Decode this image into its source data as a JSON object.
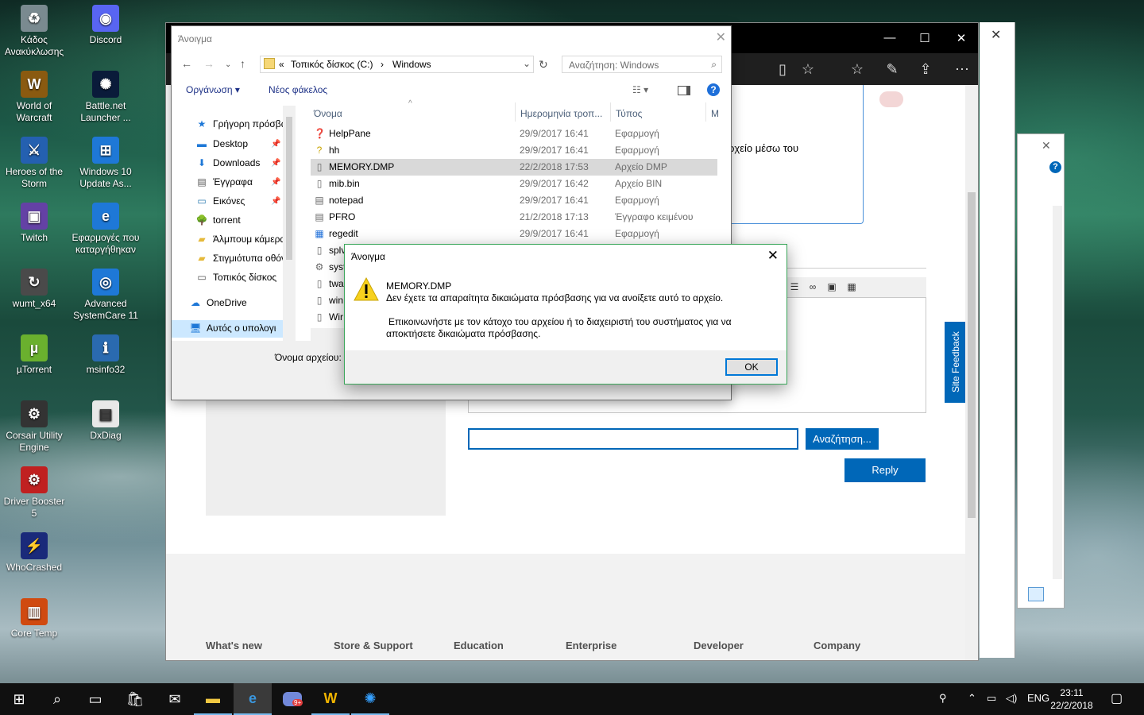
{
  "desktop": {
    "icons": [
      {
        "label": "Κάδος Ανακύκλωσης",
        "icon": "recycle-bin-icon"
      },
      {
        "label": "Discord",
        "icon": "discord-icon"
      },
      {
        "label": "World of Warcraft",
        "icon": "wow-icon"
      },
      {
        "label": "Battle.net Launcher ...",
        "icon": "battlenet-icon"
      },
      {
        "label": "Heroes of the Storm",
        "icon": "hots-icon"
      },
      {
        "label": "Windows 10 Update As...",
        "icon": "windows-update-icon"
      },
      {
        "label": "Twitch",
        "icon": "twitch-icon"
      },
      {
        "label": "Εφαρμογές που καταργήθηκαν",
        "icon": "edge-file-icon"
      },
      {
        "label": "wumt_x64",
        "icon": "wumt-icon"
      },
      {
        "label": "Advanced SystemCare 11",
        "icon": "systemcare-icon"
      },
      {
        "label": "µTorrent",
        "icon": "utorrent-icon"
      },
      {
        "label": "msinfo32",
        "icon": "msinfo-icon"
      },
      {
        "label": "Corsair Utility Engine",
        "icon": "corsair-icon"
      },
      {
        "label": "DxDiag",
        "icon": "dxdiag-icon"
      },
      {
        "label": "Driver Booster 5",
        "icon": "driver-booster-icon"
      },
      {
        "label": "WhoCrashed",
        "icon": "whocrashed-icon"
      },
      {
        "label": "Core Temp",
        "icon": "coretemp-icon"
      }
    ]
  },
  "edge": {
    "partial_text": "ρχείο μέσω του",
    "search_button": "Αναζήτηση...",
    "reply_button": "Reply",
    "site_feedback": "Site Feedback",
    "footer": [
      "What's new",
      "Store & Support",
      "Education",
      "Enterprise",
      "Developer",
      "Company"
    ]
  },
  "file_dialog": {
    "title": "Άνοιγμα",
    "address": {
      "prefix": "«",
      "drive": "Τοπικός δίσκος (C:)",
      "folder": "Windows"
    },
    "search_placeholder": "Αναζήτηση: Windows",
    "commands": {
      "organize": "Οργάνωση",
      "new_folder": "Νέος φάκελος"
    },
    "nav": [
      {
        "label": "Γρήγορη πρόσβαση",
        "icon": "star-icon",
        "pinned": false
      },
      {
        "label": "Desktop",
        "icon": "desktop-folder-icon",
        "pinned": true
      },
      {
        "label": "Downloads",
        "icon": "downloads-icon",
        "pinned": true
      },
      {
        "label": "Έγγραφα",
        "icon": "documents-icon",
        "pinned": true
      },
      {
        "label": "Εικόνες",
        "icon": "pictures-icon",
        "pinned": true
      },
      {
        "label": "torrent",
        "icon": "torrent-folder-icon",
        "pinned": false
      },
      {
        "label": "Άλμπουμ κάμερας",
        "icon": "folder-icon",
        "pinned": false
      },
      {
        "label": "Στιγμιότυπα οθόνης",
        "icon": "folder-icon",
        "pinned": false
      },
      {
        "label": "Τοπικός δίσκος",
        "icon": "drive-icon",
        "pinned": false
      },
      {
        "label": "OneDrive",
        "icon": "onedrive-icon",
        "pinned": false
      },
      {
        "label": "Αυτός ο υπολογιστής",
        "icon": "this-pc-icon",
        "pinned": false
      }
    ],
    "columns": {
      "name": "Όνομα",
      "date": "Ημερομηνία τροπ...",
      "type": "Τύπος",
      "size": "Μ"
    },
    "files": [
      {
        "name": "HelpPane",
        "date": "29/9/2017 16:41",
        "type": "Εφαρμογή",
        "icon": "help-icon"
      },
      {
        "name": "hh",
        "date": "29/9/2017 16:41",
        "type": "Εφαρμογή",
        "icon": "help-file-icon"
      },
      {
        "name": "MEMORY.DMP",
        "date": "22/2/2018 17:53",
        "type": "Αρχείο DMP",
        "icon": "file-icon"
      },
      {
        "name": "mib.bin",
        "date": "29/9/2017 16:42",
        "type": "Αρχείο BIN",
        "icon": "file-icon"
      },
      {
        "name": "notepad",
        "date": "29/9/2017 16:41",
        "type": "Εφαρμογή",
        "icon": "notepad-icon"
      },
      {
        "name": "PFRO",
        "date": "21/2/2018 17:13",
        "type": "Έγγραφο κειμένου",
        "icon": "text-file-icon"
      },
      {
        "name": "regedit",
        "date": "29/9/2017 16:41",
        "type": "Εφαρμογή",
        "icon": "regedit-icon"
      },
      {
        "name": "splv",
        "date": "",
        "type": "",
        "icon": "file-icon"
      },
      {
        "name": "syst",
        "date": "",
        "type": "",
        "icon": "settings-file-icon"
      },
      {
        "name": "twa",
        "date": "",
        "type": "",
        "icon": "file-icon"
      },
      {
        "name": "win",
        "date": "",
        "type": "",
        "icon": "file-icon"
      },
      {
        "name": "Wir",
        "date": "",
        "type": "",
        "icon": "file-icon"
      }
    ],
    "filename_label": "Όνομα αρχείου:"
  },
  "message": {
    "title": "Άνοιγμα",
    "filename": "MEMORY.DMP",
    "line1": "Δεν έχετε τα απαραίτητα δικαιώματα πρόσβασης για να ανοίξετε αυτό το αρχείο.",
    "line2": "Επικοινωνήστε με τον κάτοχο του αρχείου ή το διαχειριστή του συστήματος για να",
    "line3": "αποκτήσετε δικαιώματα πρόσβασης.",
    "ok": "OK"
  },
  "taskbar": {
    "language": "ENG",
    "time": "23:11",
    "date": "22/2/2018",
    "discord_badge": "9+"
  },
  "colors": {
    "accent": "#0067b8",
    "taskbar": "#101010",
    "selection": "#cce8ff"
  }
}
